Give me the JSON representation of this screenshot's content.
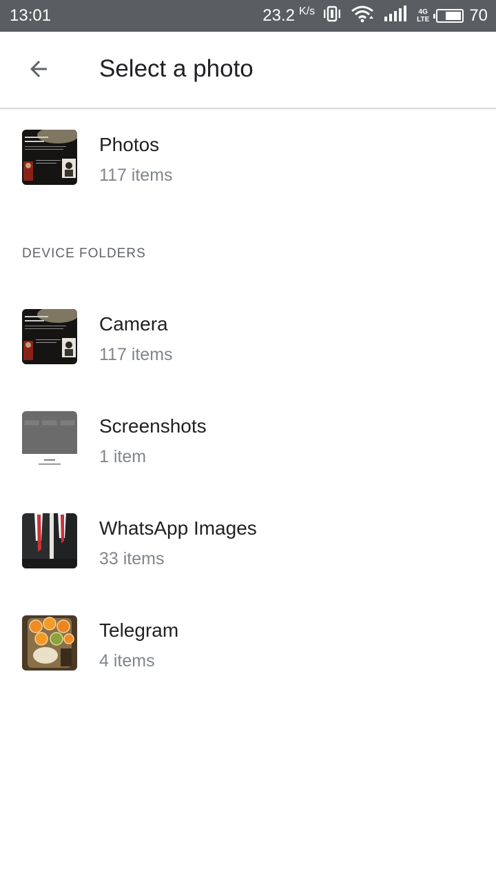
{
  "status_bar": {
    "time": "13:01",
    "net_speed": "23.2",
    "net_unit": "K/s",
    "network_type": "4G",
    "network_sub": "LTE",
    "battery_percent": "70",
    "battery_level": 0.7,
    "icons": [
      "vibrate-icon",
      "wifi-icon",
      "signal-icon",
      "battery-icon"
    ]
  },
  "app_bar": {
    "title": "Select a photo",
    "back_icon": "arrow-back-icon"
  },
  "photos": {
    "name": "Photos",
    "count": "117 items"
  },
  "device_folders": {
    "header": "DEVICE FOLDERS",
    "items": [
      {
        "name": "Camera",
        "count": "117 items"
      },
      {
        "name": "Screenshots",
        "count": "1 item"
      },
      {
        "name": "WhatsApp Images",
        "count": "33 items"
      },
      {
        "name": "Telegram",
        "count": "4 items"
      }
    ]
  },
  "colors": {
    "status_bar": "#5a5d61",
    "title_text": "#202124",
    "secondary_text": "#80868b",
    "section_header": "#5f6368"
  }
}
